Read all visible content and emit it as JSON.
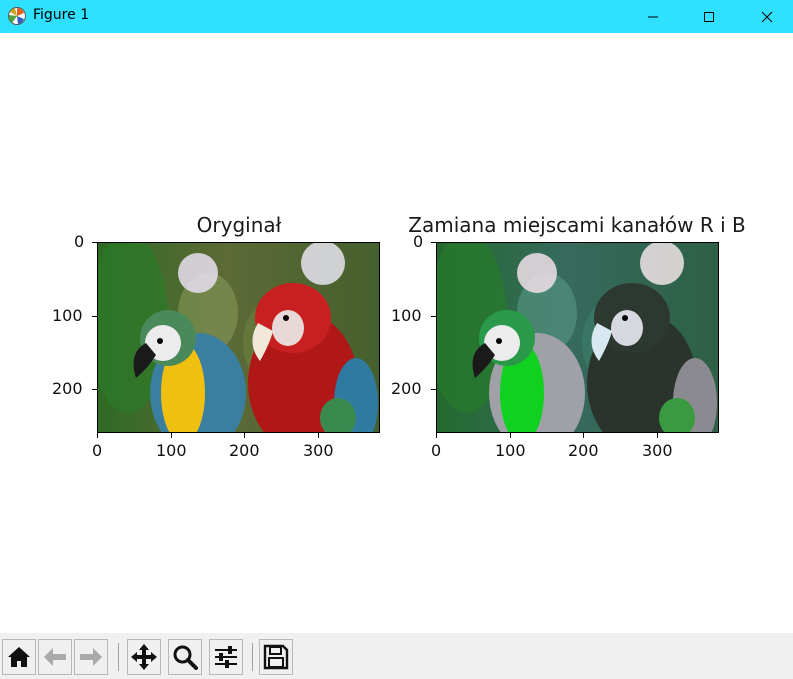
{
  "window": {
    "title": "Figure 1",
    "controls": [
      "minimize",
      "maximize",
      "close"
    ]
  },
  "subplots": [
    {
      "title": "Oryginał",
      "xticks": [
        "0",
        "100",
        "200",
        "300"
      ],
      "yticks": [
        "0",
        "100",
        "200"
      ],
      "image": "parrots photo (original colours)"
    },
    {
      "title": "Zamiana miejscami kanałów R i B",
      "xticks": [
        "0",
        "100",
        "200",
        "300"
      ],
      "yticks": [
        "0",
        "100",
        "200"
      ],
      "image": "parrots photo (R and B channels swapped)"
    }
  ],
  "toolbar": {
    "buttons": [
      "home-icon",
      "back-arrow-icon",
      "forward-arrow-icon",
      "pan-move-icon",
      "zoom-magnifier-icon",
      "configure-subplots-icon",
      "save-floppy-icon"
    ]
  },
  "colors": {
    "titlebar": "#2fe0ff",
    "toolbar": "#f0f0f0"
  }
}
